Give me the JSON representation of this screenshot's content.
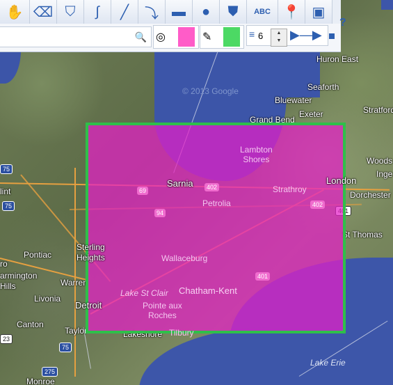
{
  "toolbar": {
    "tools": [
      {
        "name": "pan-tool",
        "glyph": "✋"
      },
      {
        "name": "eraser-tool",
        "glyph": "⌫"
      },
      {
        "name": "fill-tool",
        "glyph": "⛉"
      },
      {
        "name": "freehand-tool",
        "glyph": "∫"
      },
      {
        "name": "line-tool",
        "glyph": "╱"
      },
      {
        "name": "arc-tool",
        "glyph": "⤵"
      },
      {
        "name": "rectangle-tool",
        "glyph": "▬"
      },
      {
        "name": "circle-tool",
        "glyph": "●"
      },
      {
        "name": "polygon-tool",
        "glyph": "⛊"
      },
      {
        "name": "text-tool",
        "glyph": "ABC"
      },
      {
        "name": "marker-tool",
        "glyph": "📍"
      },
      {
        "name": "image-tool",
        "glyph": "▣"
      }
    ],
    "help_label": "?"
  },
  "search": {
    "placeholder": "",
    "value": ""
  },
  "style": {
    "fill_color": "#ff5cc8",
    "line_color": "#4cd964",
    "line_width": "6"
  },
  "map": {
    "cities": {
      "huron_east": "Huron East",
      "seaforth": "Seaforth",
      "bluewater": "Bluewater",
      "exeter": "Exeter",
      "stratford": "Stratford",
      "grand_bend": "Grand Bend",
      "lambton_shores": "Lambton\nShores",
      "sarnia": "Sarnia",
      "strathroy": "Strathroy",
      "london": "London",
      "woods": "Woods",
      "inge": "Inge",
      "dorchester": "Dorchester",
      "petrolia": "Petrolia",
      "st_thomas": "St Thomas",
      "wallaceburg": "Wallaceburg",
      "chatham_kent": "Chatham-Kent",
      "pointe_aux_roches": "Pointe aux\nRoches",
      "tilbury": "Tilbury",
      "lakeshore": "Lakeshore",
      "sterling_heights": "Sterling\nHeights",
      "pontiac": "Pontiac",
      "farmington_hills": "armington\nHills",
      "warren": "Warren",
      "livonia": "Livonia",
      "detroit": "Detroit",
      "canton": "Canton",
      "taylor": "Taylor",
      "monroe": "Monroe",
      "flint": "lint",
      "ro": "ro"
    },
    "water": {
      "lake_st_clair": "Lake St Clair",
      "lake_erie": "Lake Erie"
    },
    "copyright": "© 2013 Google",
    "shields": {
      "i69": "69",
      "i94": "94",
      "i75a": "75",
      "i75b": "75",
      "i75c": "75",
      "i275": "275",
      "i23": "23",
      "on402a": "402",
      "on402b": "402",
      "on401a": "401",
      "on401b": "401"
    }
  }
}
